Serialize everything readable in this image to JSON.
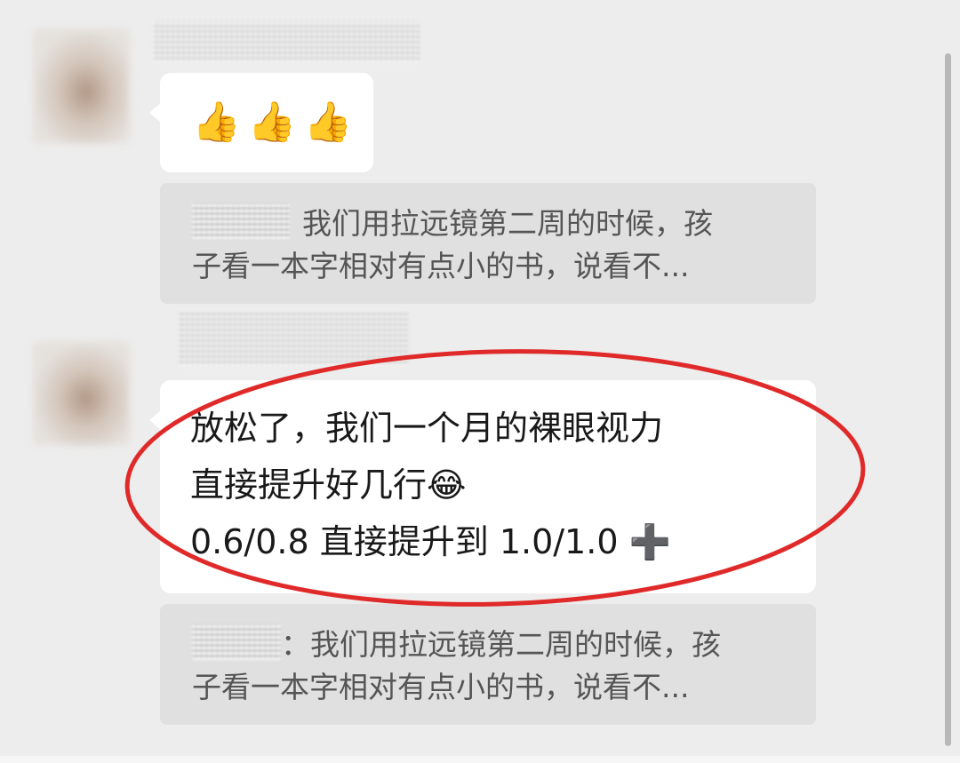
{
  "messages": [
    {
      "type": "emoji",
      "emojis": [
        "👍",
        "👍",
        "👍"
      ]
    },
    {
      "type": "quote",
      "text_line1": "我们用拉远镜第二周的时候，孩",
      "text_line2": "子看一本字相对有点小的书，说看不..."
    },
    {
      "type": "text",
      "line1": "放松了，我们一个月的裸眼视力",
      "line2": "直接提升好几行😂",
      "line3": "0.6/0.8 直接提升到 1.0/1.0 ➕"
    },
    {
      "type": "quote",
      "text_line1": "：我们用拉远镜第二周的时候，孩",
      "text_line2": "子看一本字相对有点小的书，说看不..."
    }
  ],
  "colors": {
    "background": "#ededed",
    "bubble": "#ffffff",
    "quote_bg": "#e0e0e0",
    "annotation": "#e02a2a"
  }
}
